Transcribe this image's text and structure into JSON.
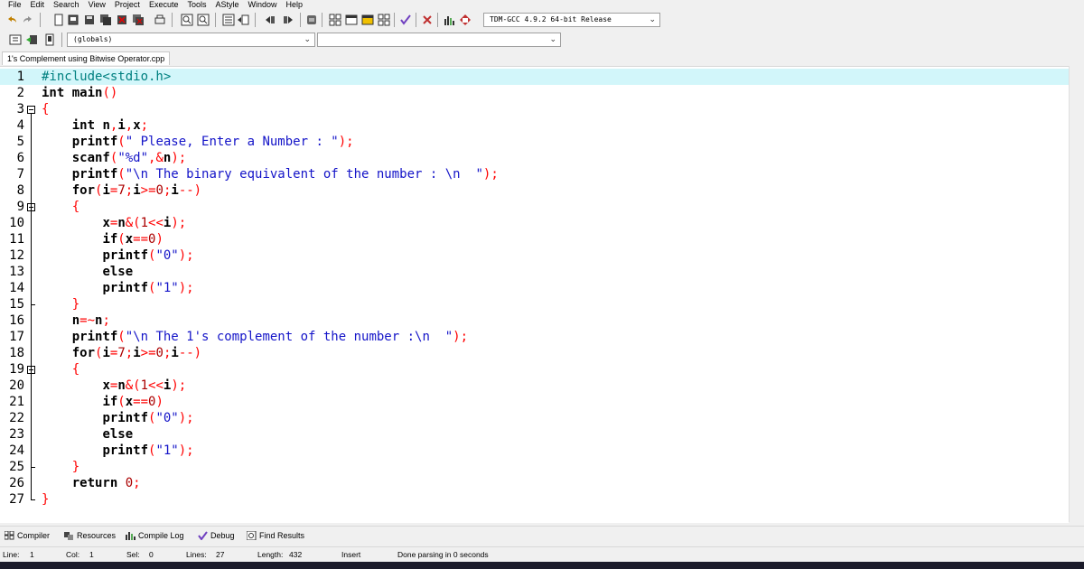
{
  "menu": [
    "File",
    "Edit",
    "Search",
    "View",
    "Project",
    "Execute",
    "Tools",
    "AStyle",
    "Window",
    "Help"
  ],
  "toolbar": {
    "compiler_select": "TDM-GCC 4.9.2 64-bit Release",
    "scope_select": "(globals)"
  },
  "tabs": [
    {
      "label": "1's Complement using Bitwise Operator.cpp"
    }
  ],
  "code_lines": [
    {
      "n": "1",
      "html": "<span class='pre'>#include&lt;stdio.h&gt;</span>"
    },
    {
      "n": "2",
      "html": "<span class='kw'>int</span> <span class='kw'>main</span><span class='sym'>()</span>"
    },
    {
      "n": "3",
      "html": "<span class='sym'>{</span>"
    },
    {
      "n": "4",
      "html": "    <span class='kw'>int</span> <span class='kw'>n</span><span class='sym'>,</span><span class='kw'>i</span><span class='sym'>,</span><span class='kw'>x</span><span class='sym'>;</span>"
    },
    {
      "n": "5",
      "html": "    <span class='kw'>printf</span><span class='sym'>(</span><span class='str'>\" Please, Enter a Number : \"</span><span class='sym'>);</span>"
    },
    {
      "n": "6",
      "html": "    <span class='kw'>scanf</span><span class='sym'>(</span><span class='str'>\"%d\"</span><span class='sym'>,&amp;</span><span class='kw'>n</span><span class='sym'>);</span>"
    },
    {
      "n": "7",
      "html": "    <span class='kw'>printf</span><span class='sym'>(</span><span class='str'>\"\\n The binary equivalent of the number : \\n  \"</span><span class='sym'>);</span>"
    },
    {
      "n": "8",
      "html": "    <span class='kw'>for</span><span class='sym'>(</span><span class='kw'>i</span><span class='sym'>=</span><span class='num'>7</span><span class='sym'>;</span><span class='kw'>i</span><span class='sym'>&gt;=</span><span class='num'>0</span><span class='sym'>;</span><span class='kw'>i</span><span class='sym'>--)</span>"
    },
    {
      "n": "9",
      "html": "    <span class='sym'>{</span>"
    },
    {
      "n": "10",
      "html": "        <span class='kw'>x</span><span class='sym'>=</span><span class='kw'>n</span><span class='sym'>&amp;(</span><span class='num'>1</span><span class='sym'>&lt;&lt;</span><span class='kw'>i</span><span class='sym'>);</span>"
    },
    {
      "n": "11",
      "html": "        <span class='kw'>if</span><span class='sym'>(</span><span class='kw'>x</span><span class='sym'>==</span><span class='num'>0</span><span class='sym'>)</span>"
    },
    {
      "n": "12",
      "html": "        <span class='kw'>printf</span><span class='sym'>(</span><span class='str'>\"0\"</span><span class='sym'>);</span>"
    },
    {
      "n": "13",
      "html": "        <span class='kw'>else</span>"
    },
    {
      "n": "14",
      "html": "        <span class='kw'>printf</span><span class='sym'>(</span><span class='str'>\"1\"</span><span class='sym'>);</span>"
    },
    {
      "n": "15",
      "html": "    <span class='sym'>}</span>"
    },
    {
      "n": "16",
      "html": "    <span class='kw'>n</span><span class='sym'>=~</span><span class='kw'>n</span><span class='sym'>;</span>"
    },
    {
      "n": "17",
      "html": "    <span class='kw'>printf</span><span class='sym'>(</span><span class='str'>\"\\n The 1's complement of the number :\\n  \"</span><span class='sym'>);</span>"
    },
    {
      "n": "18",
      "html": "    <span class='kw'>for</span><span class='sym'>(</span><span class='kw'>i</span><span class='sym'>=</span><span class='num'>7</span><span class='sym'>;</span><span class='kw'>i</span><span class='sym'>&gt;=</span><span class='num'>0</span><span class='sym'>;</span><span class='kw'>i</span><span class='sym'>--)</span>"
    },
    {
      "n": "19",
      "html": "    <span class='sym'>{</span>"
    },
    {
      "n": "20",
      "html": "        <span class='kw'>x</span><span class='sym'>=</span><span class='kw'>n</span><span class='sym'>&amp;(</span><span class='num'>1</span><span class='sym'>&lt;&lt;</span><span class='kw'>i</span><span class='sym'>);</span>"
    },
    {
      "n": "21",
      "html": "        <span class='kw'>if</span><span class='sym'>(</span><span class='kw'>x</span><span class='sym'>==</span><span class='num'>0</span><span class='sym'>)</span>"
    },
    {
      "n": "22",
      "html": "        <span class='kw'>printf</span><span class='sym'>(</span><span class='str'>\"0\"</span><span class='sym'>);</span>"
    },
    {
      "n": "23",
      "html": "        <span class='kw'>else</span>"
    },
    {
      "n": "24",
      "html": "        <span class='kw'>printf</span><span class='sym'>(</span><span class='str'>\"1\"</span><span class='sym'>);</span>"
    },
    {
      "n": "25",
      "html": "    <span class='sym'>}</span>"
    },
    {
      "n": "26",
      "html": "    <span class='kw'>return</span> <span class='num'>0</span><span class='sym'>;</span>"
    },
    {
      "n": "27",
      "html": "<span class='sym'>}</span>"
    }
  ],
  "fold_markers": [
    "3",
    "9",
    "19"
  ],
  "panel_tabs": [
    {
      "label": "Compiler",
      "icon": "compiler-icon"
    },
    {
      "label": "Resources",
      "icon": "resources-icon"
    },
    {
      "label": "Compile Log",
      "icon": "compile-log-icon"
    },
    {
      "label": "Debug",
      "icon": "debug-icon"
    },
    {
      "label": "Find Results",
      "icon": "find-results-icon"
    }
  ],
  "status": {
    "line_label": "Line:",
    "line_value": "1",
    "col_label": "Col:",
    "col_value": "1",
    "sel_label": "Sel:",
    "sel_value": "0",
    "lines_label": "Lines:",
    "lines_value": "27",
    "length_label": "Length:",
    "length_value": "432",
    "mode": "Insert",
    "message": "Done parsing in 0 seconds"
  },
  "colors": {
    "highlight": "#d2f6fa",
    "string": "#1414c8",
    "preprocessor": "#008080",
    "number": "#aa0000",
    "symbol": "#ff0000"
  }
}
